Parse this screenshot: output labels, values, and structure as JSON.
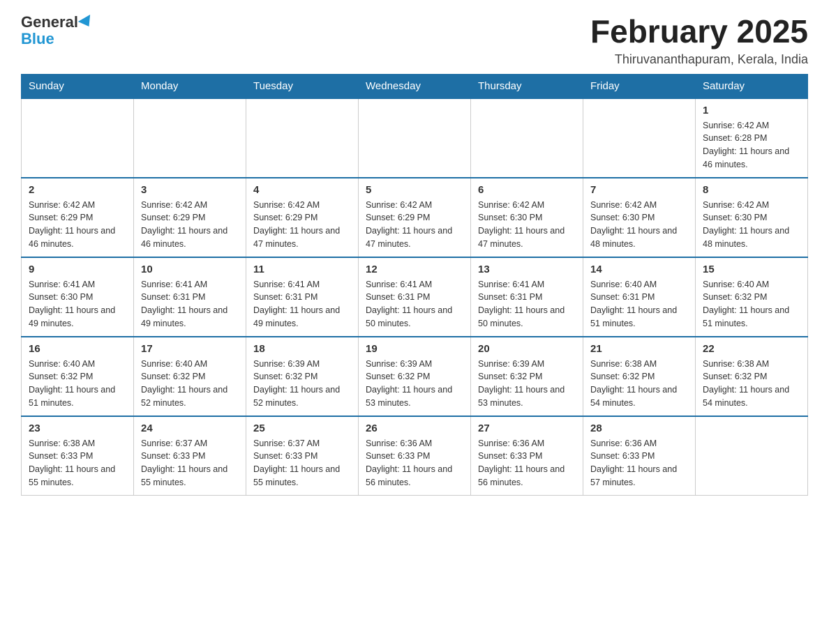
{
  "logo": {
    "general": "General",
    "blue": "Blue",
    "triangle_alt": "triangle logo"
  },
  "title": "February 2025",
  "subtitle": "Thiruvananthapuram, Kerala, India",
  "days_of_week": [
    "Sunday",
    "Monday",
    "Tuesday",
    "Wednesday",
    "Thursday",
    "Friday",
    "Saturday"
  ],
  "weeks": [
    [
      {
        "day": "",
        "info": ""
      },
      {
        "day": "",
        "info": ""
      },
      {
        "day": "",
        "info": ""
      },
      {
        "day": "",
        "info": ""
      },
      {
        "day": "",
        "info": ""
      },
      {
        "day": "",
        "info": ""
      },
      {
        "day": "1",
        "info": "Sunrise: 6:42 AM\nSunset: 6:28 PM\nDaylight: 11 hours and 46 minutes."
      }
    ],
    [
      {
        "day": "2",
        "info": "Sunrise: 6:42 AM\nSunset: 6:29 PM\nDaylight: 11 hours and 46 minutes."
      },
      {
        "day": "3",
        "info": "Sunrise: 6:42 AM\nSunset: 6:29 PM\nDaylight: 11 hours and 46 minutes."
      },
      {
        "day": "4",
        "info": "Sunrise: 6:42 AM\nSunset: 6:29 PM\nDaylight: 11 hours and 47 minutes."
      },
      {
        "day": "5",
        "info": "Sunrise: 6:42 AM\nSunset: 6:29 PM\nDaylight: 11 hours and 47 minutes."
      },
      {
        "day": "6",
        "info": "Sunrise: 6:42 AM\nSunset: 6:30 PM\nDaylight: 11 hours and 47 minutes."
      },
      {
        "day": "7",
        "info": "Sunrise: 6:42 AM\nSunset: 6:30 PM\nDaylight: 11 hours and 48 minutes."
      },
      {
        "day": "8",
        "info": "Sunrise: 6:42 AM\nSunset: 6:30 PM\nDaylight: 11 hours and 48 minutes."
      }
    ],
    [
      {
        "day": "9",
        "info": "Sunrise: 6:41 AM\nSunset: 6:30 PM\nDaylight: 11 hours and 49 minutes."
      },
      {
        "day": "10",
        "info": "Sunrise: 6:41 AM\nSunset: 6:31 PM\nDaylight: 11 hours and 49 minutes."
      },
      {
        "day": "11",
        "info": "Sunrise: 6:41 AM\nSunset: 6:31 PM\nDaylight: 11 hours and 49 minutes."
      },
      {
        "day": "12",
        "info": "Sunrise: 6:41 AM\nSunset: 6:31 PM\nDaylight: 11 hours and 50 minutes."
      },
      {
        "day": "13",
        "info": "Sunrise: 6:41 AM\nSunset: 6:31 PM\nDaylight: 11 hours and 50 minutes."
      },
      {
        "day": "14",
        "info": "Sunrise: 6:40 AM\nSunset: 6:31 PM\nDaylight: 11 hours and 51 minutes."
      },
      {
        "day": "15",
        "info": "Sunrise: 6:40 AM\nSunset: 6:32 PM\nDaylight: 11 hours and 51 minutes."
      }
    ],
    [
      {
        "day": "16",
        "info": "Sunrise: 6:40 AM\nSunset: 6:32 PM\nDaylight: 11 hours and 51 minutes."
      },
      {
        "day": "17",
        "info": "Sunrise: 6:40 AM\nSunset: 6:32 PM\nDaylight: 11 hours and 52 minutes."
      },
      {
        "day": "18",
        "info": "Sunrise: 6:39 AM\nSunset: 6:32 PM\nDaylight: 11 hours and 52 minutes."
      },
      {
        "day": "19",
        "info": "Sunrise: 6:39 AM\nSunset: 6:32 PM\nDaylight: 11 hours and 53 minutes."
      },
      {
        "day": "20",
        "info": "Sunrise: 6:39 AM\nSunset: 6:32 PM\nDaylight: 11 hours and 53 minutes."
      },
      {
        "day": "21",
        "info": "Sunrise: 6:38 AM\nSunset: 6:32 PM\nDaylight: 11 hours and 54 minutes."
      },
      {
        "day": "22",
        "info": "Sunrise: 6:38 AM\nSunset: 6:32 PM\nDaylight: 11 hours and 54 minutes."
      }
    ],
    [
      {
        "day": "23",
        "info": "Sunrise: 6:38 AM\nSunset: 6:33 PM\nDaylight: 11 hours and 55 minutes."
      },
      {
        "day": "24",
        "info": "Sunrise: 6:37 AM\nSunset: 6:33 PM\nDaylight: 11 hours and 55 minutes."
      },
      {
        "day": "25",
        "info": "Sunrise: 6:37 AM\nSunset: 6:33 PM\nDaylight: 11 hours and 55 minutes."
      },
      {
        "day": "26",
        "info": "Sunrise: 6:36 AM\nSunset: 6:33 PM\nDaylight: 11 hours and 56 minutes."
      },
      {
        "day": "27",
        "info": "Sunrise: 6:36 AM\nSunset: 6:33 PM\nDaylight: 11 hours and 56 minutes."
      },
      {
        "day": "28",
        "info": "Sunrise: 6:36 AM\nSunset: 6:33 PM\nDaylight: 11 hours and 57 minutes."
      },
      {
        "day": "",
        "info": ""
      }
    ]
  ]
}
